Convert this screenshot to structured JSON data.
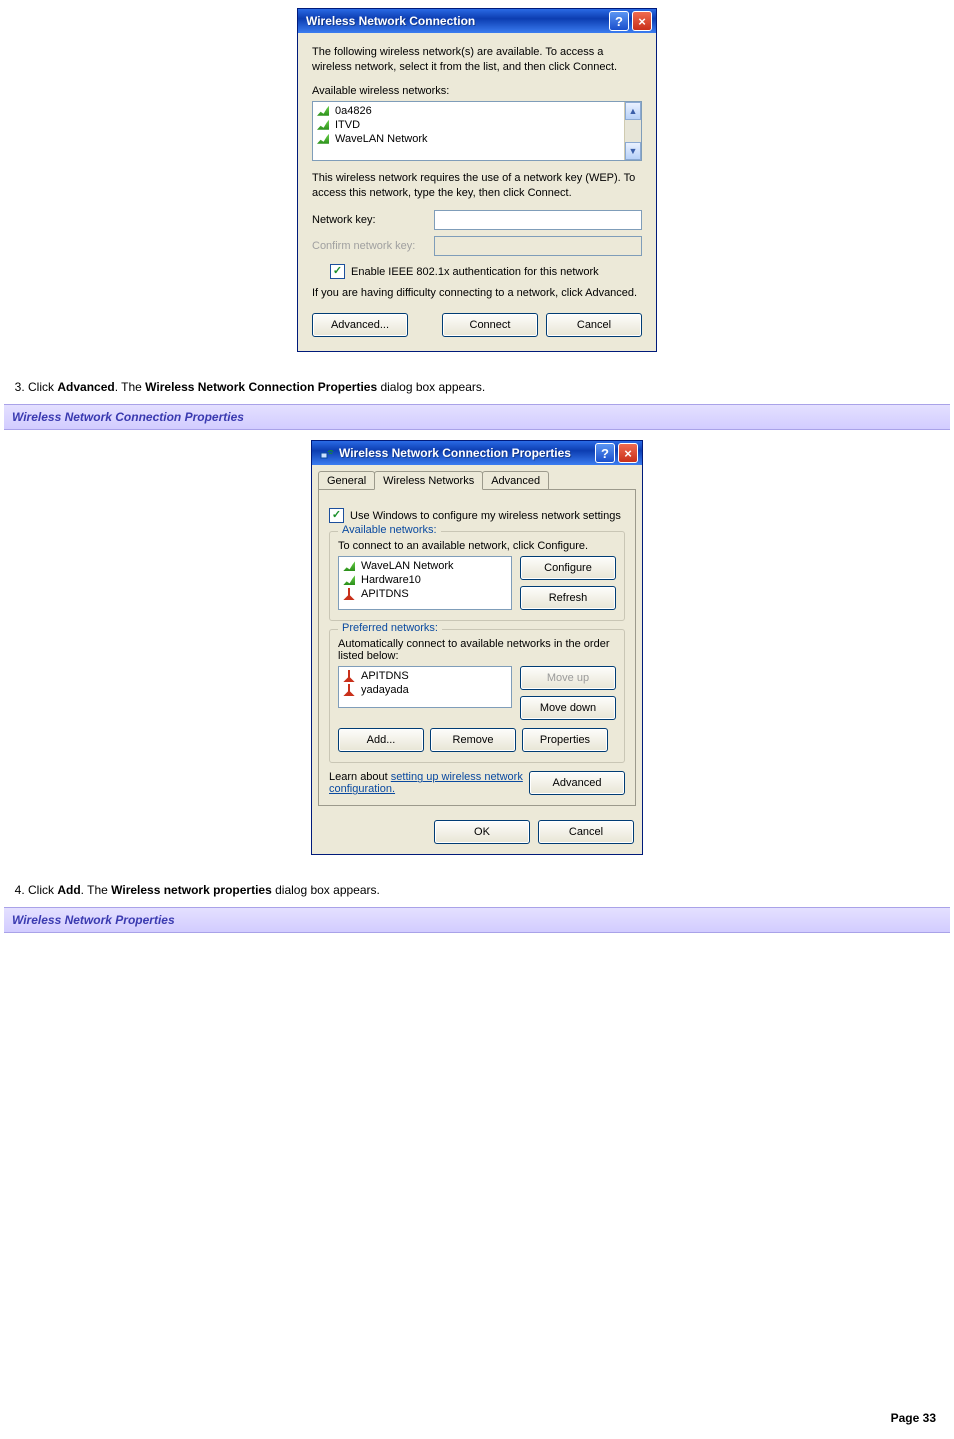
{
  "dialog1": {
    "title": "Wireless Network Connection",
    "intro": "The following wireless network(s) are available. To access a wireless network, select it from the list, and then click Connect.",
    "available_label": "Available wireless networks:",
    "networks": [
      "0a4826",
      "ITVD",
      "WaveLAN Network"
    ],
    "wep_text": "This wireless network requires the use of a network key (WEP). To access this network, type the key, then click Connect.",
    "network_key_label": "Network key:",
    "confirm_label": "Confirm network key:",
    "ieee_label": "Enable IEEE 802.1x authentication for this network",
    "difficulty_text": "If you are having difficulty connecting to a network, click Advanced.",
    "advanced_btn": "Advanced...",
    "connect_btn": "Connect",
    "cancel_btn": "Cancel"
  },
  "step3": {
    "num": "3.",
    "prefix": "Click ",
    "bold1": "Advanced",
    "mid": ". The ",
    "bold2": "Wireless Network Connection Properties",
    "suffix": " dialog box appears."
  },
  "bar1": "Wireless Network Connection Properties",
  "dialog2": {
    "title": "Wireless Network Connection Properties",
    "tabs": {
      "general": "General",
      "wireless": "Wireless Networks",
      "advanced": "Advanced"
    },
    "use_windows": "Use Windows to configure my wireless network settings",
    "available_legend": "Available networks:",
    "available_desc": "To connect to an available network, click Configure.",
    "available_list": [
      "WaveLAN Network",
      "Hardware10",
      "APITDNS"
    ],
    "configure_btn": "Configure",
    "refresh_btn": "Refresh",
    "preferred_legend": "Preferred networks:",
    "preferred_desc": "Automatically connect to available networks in the order listed below:",
    "preferred_list": [
      "APITDNS",
      "yadayada"
    ],
    "moveup_btn": "Move up",
    "movedown_btn": "Move down",
    "add_btn": "Add...",
    "remove_btn": "Remove",
    "properties_btn": "Properties",
    "learn_prefix": "Learn about ",
    "learn_link": "setting up wireless network configuration.",
    "advanced_btn": "Advanced",
    "ok_btn": "OK",
    "cancel_btn": "Cancel"
  },
  "step4": {
    "num": "4.",
    "prefix": "Click ",
    "bold1": "Add",
    "mid": ". The ",
    "bold2": "Wireless network properties",
    "suffix": " dialog box appears."
  },
  "bar2": "Wireless Network Properties",
  "footer": "Page 33"
}
